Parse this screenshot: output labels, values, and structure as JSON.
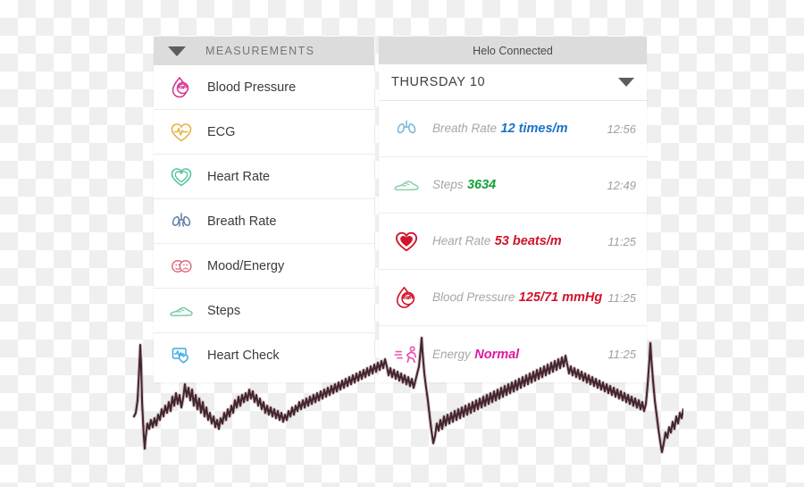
{
  "left_panel": {
    "header": {
      "title": "MEASUREMENTS",
      "caret_icon": "chevron-down-icon"
    },
    "items": [
      {
        "label": "Blood Pressure",
        "icon": "blood-pressure-icon",
        "color": "#d6338f"
      },
      {
        "label": "ECG",
        "icon": "ecg-heart-icon",
        "color": "#e8b341"
      },
      {
        "label": "Heart Rate",
        "icon": "heart-outline-icon",
        "color": "#57c4a0"
      },
      {
        "label": "Breath Rate",
        "icon": "lungs-icon",
        "color": "#5e7ca8"
      },
      {
        "label": "Mood/Energy",
        "icon": "mood-faces-icon",
        "color": "#e0687f"
      },
      {
        "label": "Steps",
        "icon": "shoe-icon",
        "color": "#7fc9a3"
      },
      {
        "label": "Heart Check",
        "icon": "heart-check-icon",
        "color": "#3fa9e0"
      }
    ]
  },
  "right_panel": {
    "header": {
      "title": "Helo Connected"
    },
    "day_bar": {
      "label": "THURSDAY  10",
      "caret_icon": "chevron-down-icon"
    },
    "readings": [
      {
        "name": "Breath Rate",
        "value": "12 times/m",
        "time": "12:56",
        "icon": "lungs-icon",
        "value_color": "#1a73c8",
        "icon_color": "#7fb7dd"
      },
      {
        "name": "Steps",
        "value": "3634",
        "time": "12:49",
        "icon": "shoe-icon",
        "value_color": "#14a33c",
        "icon_color": "#8fd3ab"
      },
      {
        "name": "Heart Rate",
        "value": "53 beats/m",
        "time": "11:25",
        "icon": "heart-filled-icon",
        "value_color": "#cf142b",
        "icon_color": "#cf142b"
      },
      {
        "name": "Blood Pressure",
        "value": "125/71 mmHg",
        "time": "11:25",
        "icon": "blood-pressure-icon",
        "value_color": "#cf142b",
        "icon_color": "#cf142b"
      },
      {
        "name": "Energy",
        "value": "Normal",
        "time": "11:25",
        "icon": "running-person-icon",
        "value_color": "#e0189c",
        "icon_color": "#ee4fb4"
      }
    ]
  },
  "ecg_waveform": {
    "name": "ecg-trace",
    "stroke_color": "#2b1418",
    "accent_color": "#5c2a36"
  }
}
